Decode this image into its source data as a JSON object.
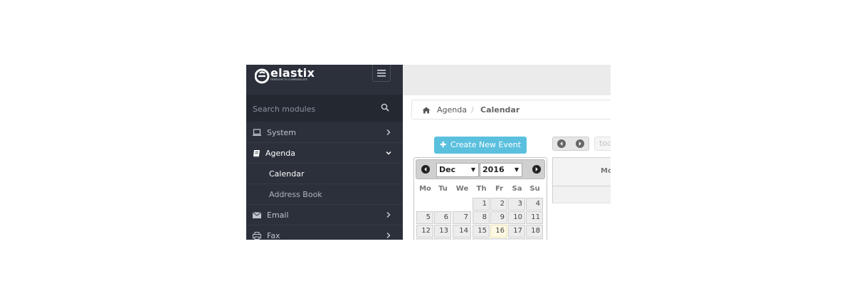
{
  "app": {
    "logo_text": "elastix",
    "logo_tagline": "FREEDOM TO COMMUNICATE",
    "menu_toggle_icon": "hamburger-icon"
  },
  "sidebar": {
    "search_placeholder": "Search modules",
    "items": [
      {
        "label": "System",
        "icon": "laptop-icon"
      },
      {
        "label": "Agenda",
        "icon": "book-icon"
      },
      {
        "label": "Email",
        "icon": "envelope-icon"
      },
      {
        "label": "Fax",
        "icon": "printer-icon"
      }
    ],
    "sub_items": [
      {
        "label": "Calendar"
      },
      {
        "label": "Address Book"
      }
    ]
  },
  "breadcrumb": {
    "parent": "Agenda",
    "separator": "/",
    "current": "Calendar"
  },
  "toolbar": {
    "create_label": "Create New Event",
    "today_label": "tod"
  },
  "calendar_view": {
    "first_day_header": "Mo"
  },
  "datepicker": {
    "month": "Dec",
    "year": "2016",
    "weekdays": [
      "Mo",
      "Tu",
      "We",
      "Th",
      "Fr",
      "Sa",
      "Su"
    ],
    "week1": [
      "",
      "",
      "",
      "1",
      "2",
      "3",
      "4"
    ],
    "week2": [
      "5",
      "6",
      "7",
      "8",
      "9",
      "10",
      "11"
    ],
    "week3": [
      "12",
      "13",
      "14",
      "15",
      "16",
      "17",
      "18"
    ],
    "today": "16"
  },
  "colors": {
    "sidebar_bg": "#2b303b",
    "accent": "#5bc0de",
    "today_bg": "#fcf8e3"
  }
}
